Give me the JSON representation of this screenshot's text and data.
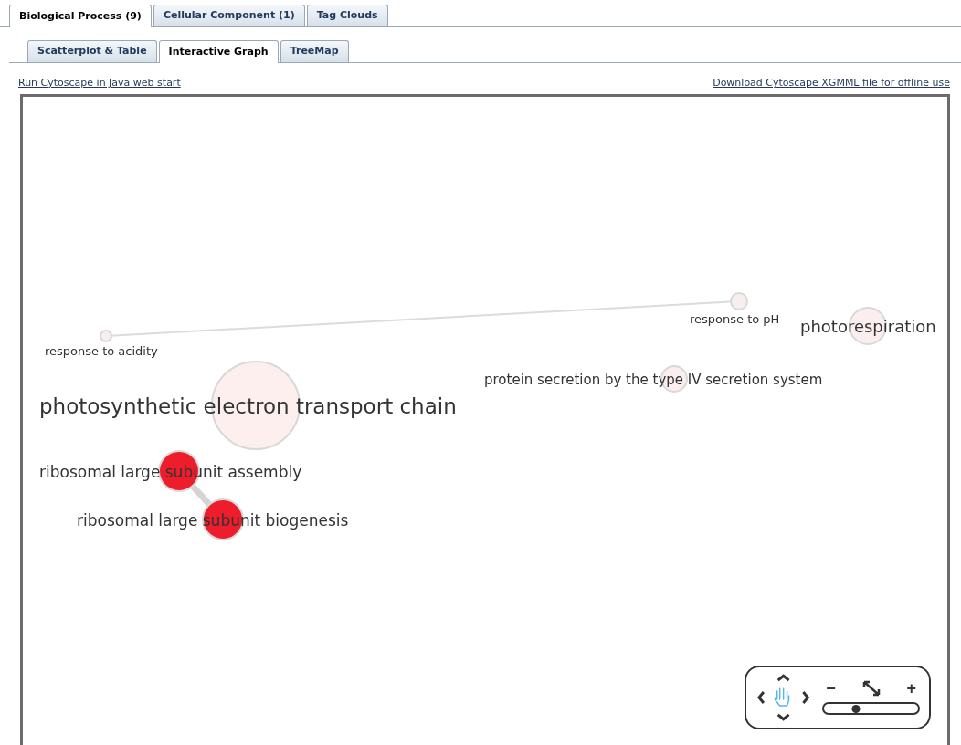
{
  "main_tabs": [
    {
      "label": "Biological Process (9)",
      "selected": true
    },
    {
      "label": "Cellular Component (1)",
      "selected": false
    },
    {
      "label": "Tag Clouds",
      "selected": false
    }
  ],
  "view_tabs": [
    {
      "label": "Scatterplot & Table",
      "selected": false
    },
    {
      "label": "Interactive Graph",
      "selected": true
    },
    {
      "label": "TreeMap",
      "selected": false
    }
  ],
  "links": {
    "left": "Run Cytoscape in Java web start",
    "right": "Download Cytoscape XGMML file for offline use"
  },
  "graph": {
    "nodes": [
      {
        "label": "response to pH",
        "color": "#f7eeee"
      },
      {
        "label": "photorespiration",
        "color": "#fbeeee"
      },
      {
        "label": "response to acidity",
        "color": "#f7eeee"
      },
      {
        "label": "protein secretion by the type IV secretion system",
        "color": "#fbeeee"
      },
      {
        "label": "photosynthetic electron transport chain",
        "color": "#fcefee"
      },
      {
        "label": "ribosomal large subunit assembly",
        "color": "#ee1d2b"
      },
      {
        "label": "ribosomal large subunit biogenesis",
        "color": "#ee1d2b"
      }
    ],
    "navigator": {
      "zoom_out": "−",
      "zoom_in": "+",
      "zoom": {
        "level": 0.34
      }
    }
  }
}
